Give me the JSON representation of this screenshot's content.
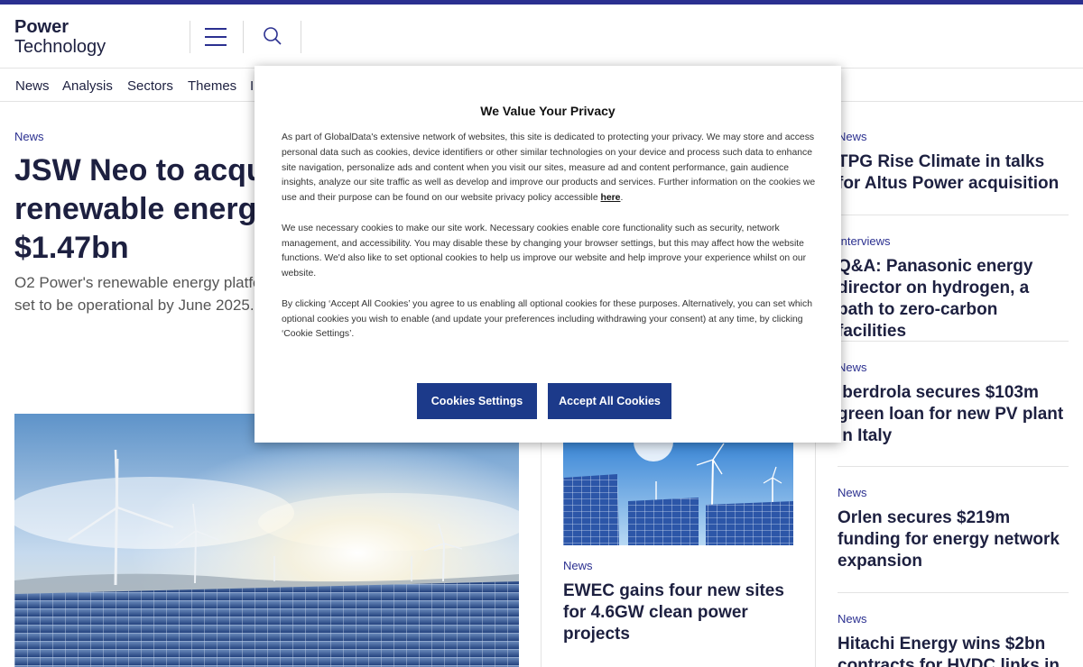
{
  "header": {
    "logo_line1": "Power",
    "logo_line2": "Technology",
    "menu_icon": "hamburger-menu-icon",
    "search_icon": "search-icon"
  },
  "nav": {
    "items": [
      "News",
      "Analysis",
      "Sectors",
      "Themes",
      "I"
    ]
  },
  "lead": {
    "category": "News",
    "title_lines": [
      "JSW Neo to acqu",
      "renewable energy",
      "$1.47bn"
    ],
    "desc_lines": [
      "O2 Power's renewable energy platfo",
      "set to be operational by June 2025."
    ]
  },
  "mid": {
    "category": "News",
    "title": "EWEC gains four new sites for 4.6GW clean power projects"
  },
  "sidebar": {
    "items": [
      {
        "category": "News",
        "title": "TPG Rise Climate in talks for Altus Power acquisition"
      },
      {
        "category": "Interviews",
        "title": "Q&A: Panasonic energy director on hydrogen, a path to zero-carbon facilities"
      },
      {
        "category": "News",
        "title": "Iberdrola secures $103m green loan for new PV plant in Italy"
      },
      {
        "category": "News",
        "title": "Orlen secures $219m funding for energy network expansion"
      },
      {
        "category": "News",
        "title": "Hitachi Energy wins $2bn contracts for HVDC links in"
      }
    ]
  },
  "cookie_modal": {
    "title": "We Value Your Privacy",
    "p1": "As part of GlobalData's extensive network of websites, this site is dedicated to protecting your privacy. We may store and access personal data such as cookies, device identifiers or other similar technologies on your device and process such data to enhance site navigation, personalize ads and content when you visit our sites, measure ad and content performance, gain audience insights, analyze our site traffic as well as develop and improve our products and services. Further information on the cookies we use and their purpose can be found on our website privacy policy accessible",
    "p1_link": "here",
    "p2": "We use necessary cookies to make our site work. Necessary cookies enable core functionality such as security, network management, and accessibility. You may disable these by changing your browser settings, but this may affect how the website functions. We'd also like to set optional cookies to help us improve our website and help improve your experience whilst on our website.",
    "p3": "By clicking ‘Accept All Cookies’ you agree to us enabling all optional cookies for these purposes. Alternatively, you can set which optional cookies you wish to enable (and update your preferences including withdrawing your consent) at any time, by clicking ‘Cookie Settings’.",
    "settings_label": "Cookies Settings",
    "accept_label": "Accept All Cookies"
  },
  "colors": {
    "accent": "#2b3090",
    "text_dark": "#1d2040",
    "button_bg": "#1c3a8a"
  }
}
